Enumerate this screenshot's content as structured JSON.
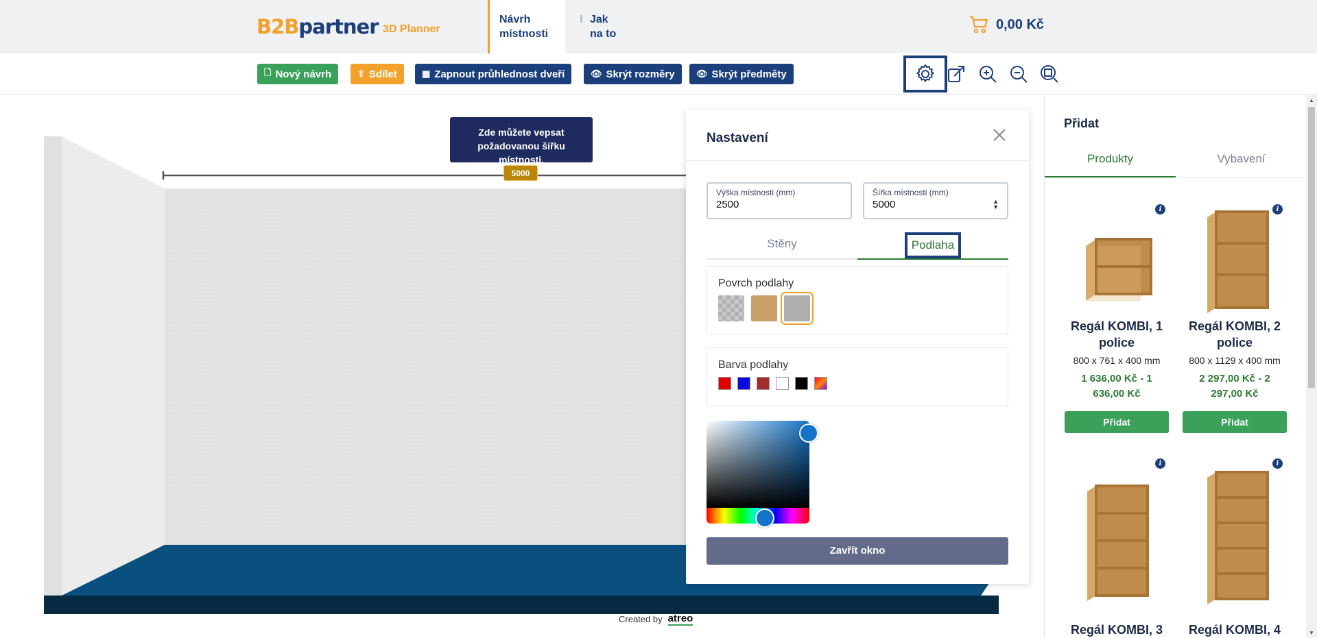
{
  "header": {
    "logo_b2b": "B2B",
    "logo_partner": "partner",
    "logo_sub": "3D Planner",
    "nav": [
      {
        "line1": "Návrh",
        "line2": "místnosti"
      },
      {
        "line1": "Jak",
        "line2": "na to"
      }
    ],
    "cart_amount": "0,00 Kč"
  },
  "toolbar": {
    "new_design": "Nový návrh",
    "share": "Sdílet",
    "door_transparency": "Zapnout průhlednost dveří",
    "hide_dimensions": "Skrýt rozměry",
    "hide_items": "Skrýt předměty"
  },
  "canvas": {
    "tooltip": "Zde můžete vepsat požadovanou šířku místnosti.",
    "width_badge": "5000",
    "created_by": "Created by",
    "created_brand": "atreo"
  },
  "settings": {
    "title": "Nastavení",
    "height_label": "Výška místnosti (mm)",
    "height_value": "2500",
    "width_label": "Šířka místnosti (mm)",
    "width_value": "5000",
    "tabs": [
      "Stěny",
      "Podlaha"
    ],
    "floor_surface_title": "Povrch podlahy",
    "floor_color_title": "Barva podlahy",
    "floor_colors": [
      "#e00000",
      "#0a0adf",
      "#a52a2a",
      "#ffffff",
      "#000000",
      "gradient"
    ],
    "picked_color": "#1373c8",
    "close_button": "Zavřít okno"
  },
  "panel": {
    "title": "Přidat",
    "tabs": [
      "Produkty",
      "Vybavení"
    ],
    "products": [
      {
        "name": "Regál KOMBI, 1 police",
        "dims": "800 x 761 x 400 mm",
        "price": "1 636,00 Kč - 1 636,00 Kč",
        "button": "Přidat"
      },
      {
        "name": "Regál KOMBI, 2 police",
        "dims": "800 x 1129 x 400 mm",
        "price": "2 297,00 Kč - 2 297,00 Kč",
        "button": "Přidat"
      },
      {
        "name": "Regál KOMBI, 3",
        "dims": "",
        "price": "",
        "button": ""
      },
      {
        "name": "Regál KOMBI, 4",
        "dims": "",
        "price": "",
        "button": ""
      }
    ]
  }
}
